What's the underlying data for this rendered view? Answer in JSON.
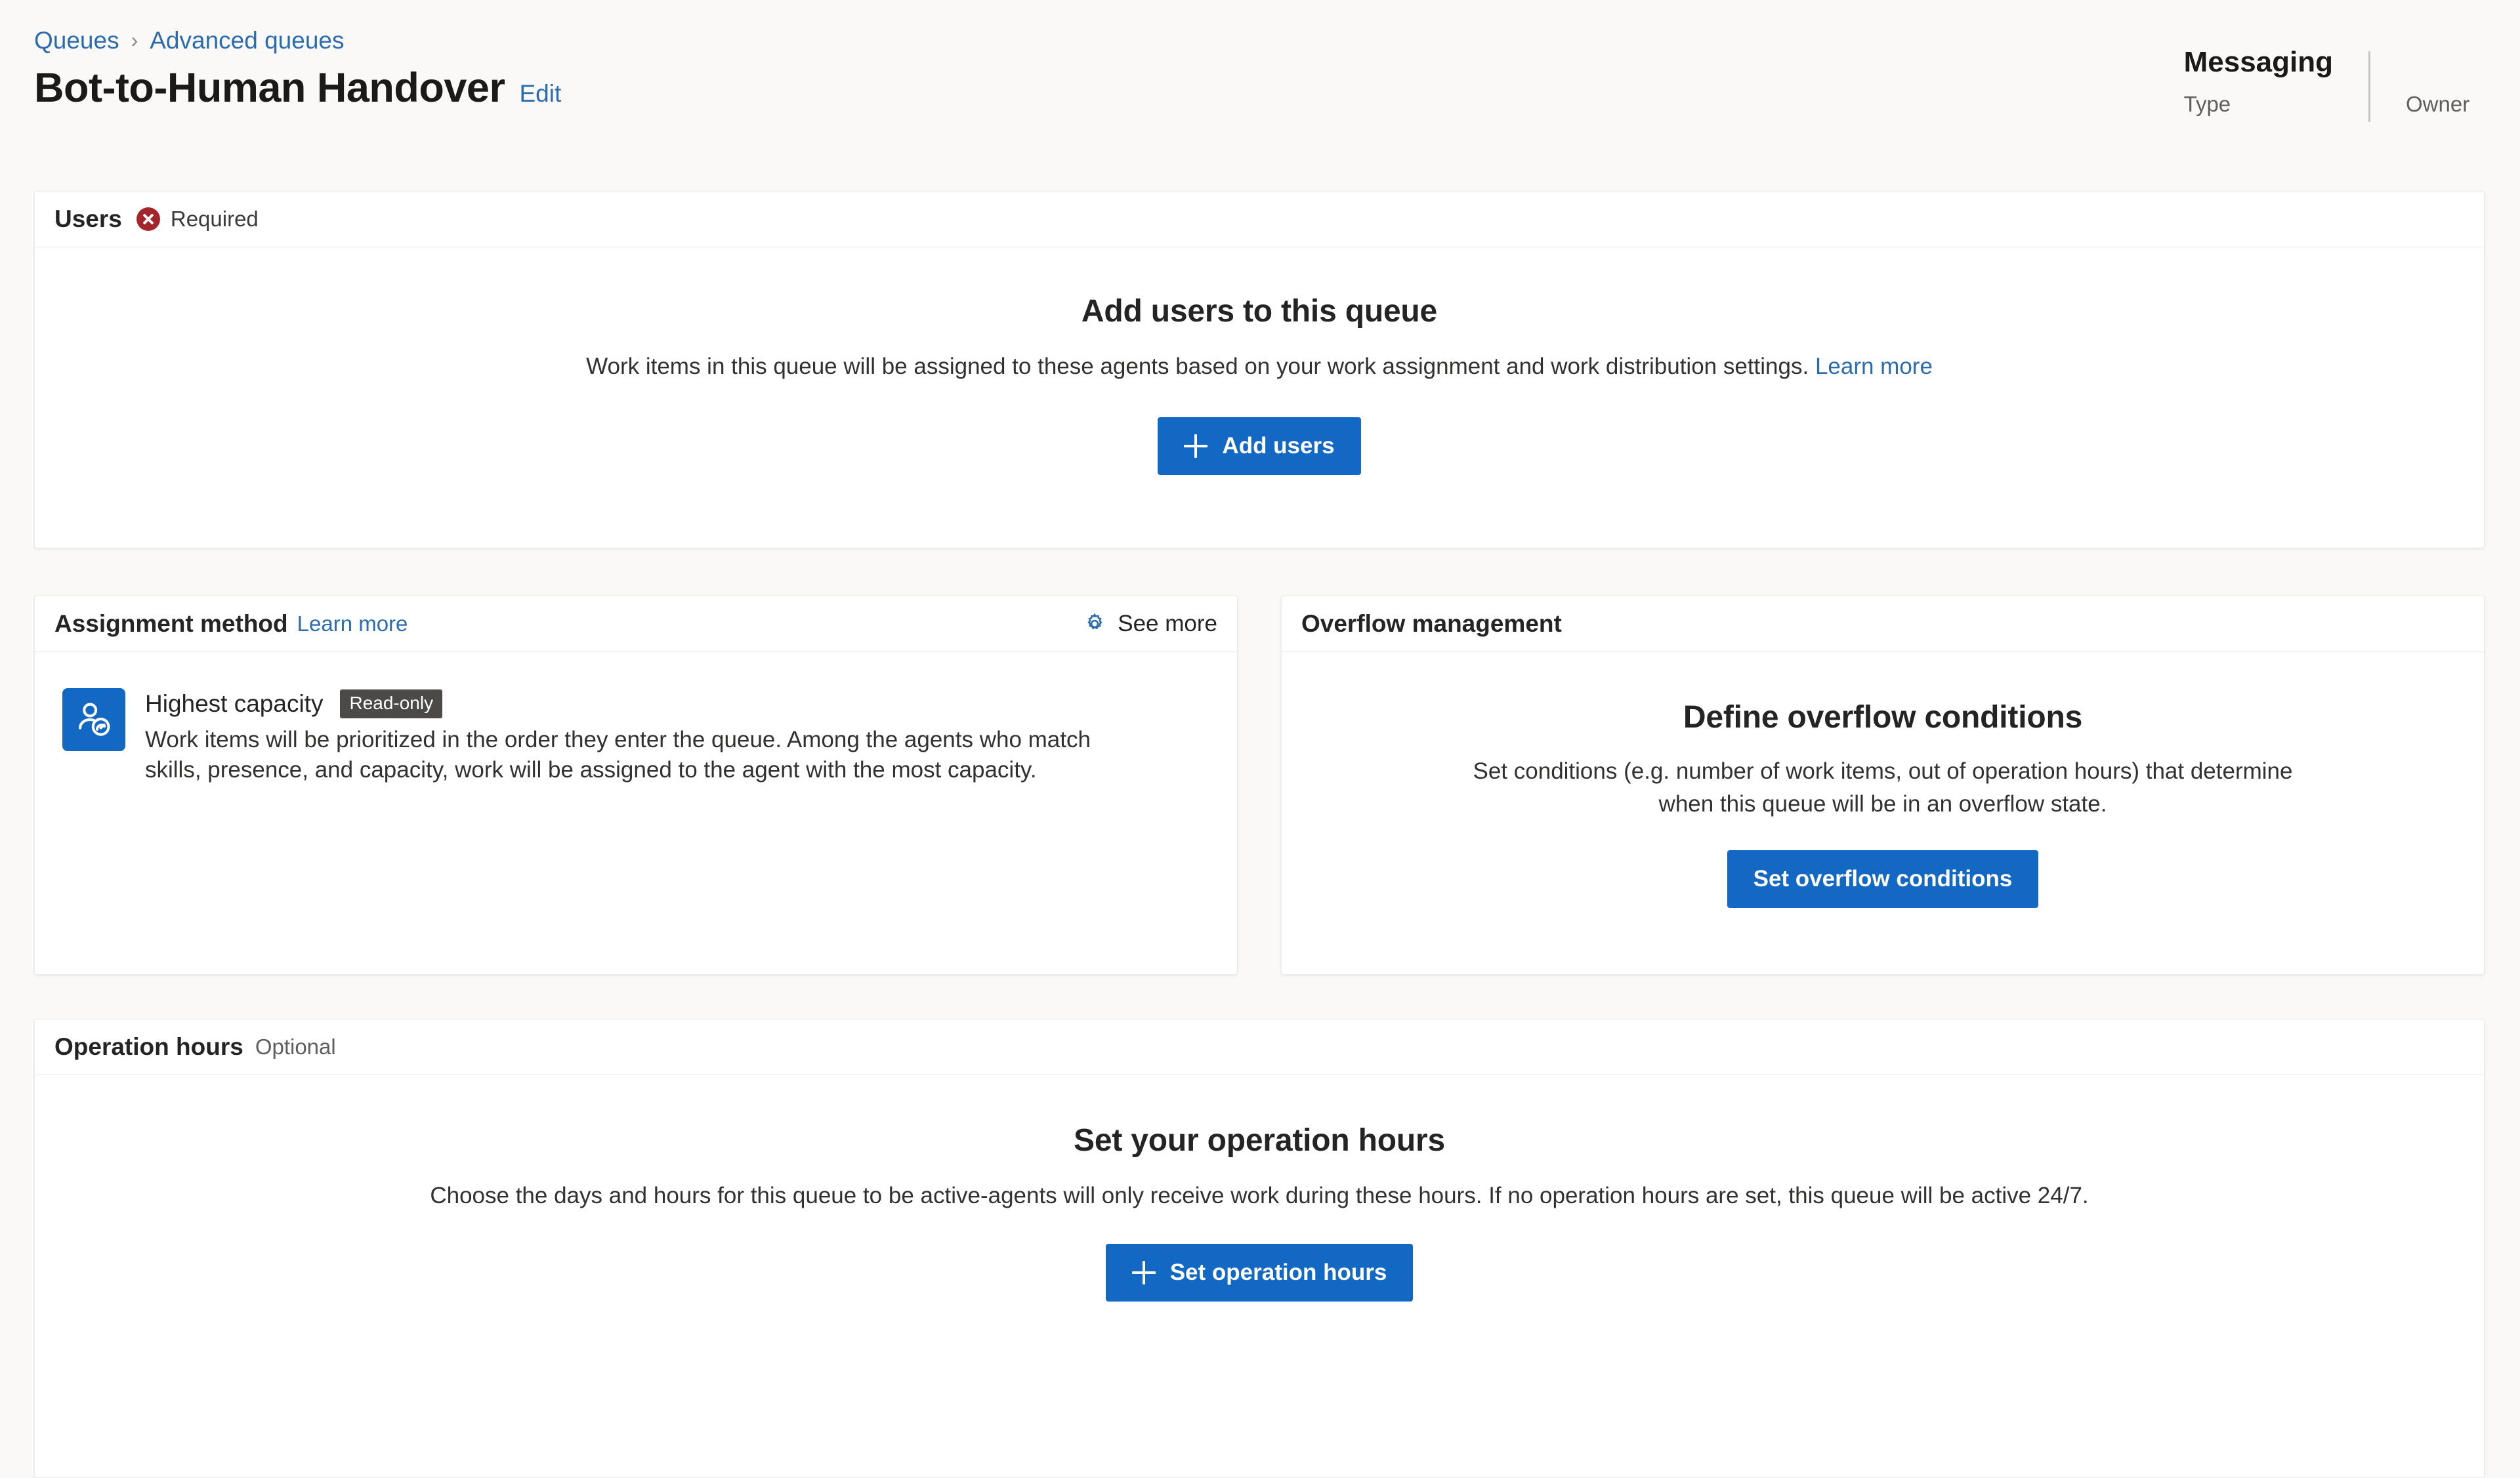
{
  "header": {
    "breadcrumb": [
      {
        "label": "Queues"
      },
      {
        "label": "Advanced queues"
      }
    ],
    "separator": "›",
    "title": "Bot-to-Human Handover",
    "edit_label": "Edit",
    "meta": {
      "type_value": "Messaging",
      "type_label": "Type",
      "owner_value": "",
      "owner_label": "Owner"
    }
  },
  "users_card": {
    "header_title": "Users",
    "required_label": "Required",
    "status_icon": "error-circle-icon",
    "empty_title": "Add users to this queue",
    "empty_desc": "Work items in this queue will be assigned to these agents based on your work assignment and work distribution settings.",
    "learn_more": "Learn more",
    "button_label": "Add users",
    "button_icon": "plus-icon"
  },
  "assignment_card": {
    "header_title": "Assignment method",
    "header_link": "Learn more",
    "see_more_label": "See more",
    "see_more_icon": "gear-icon",
    "method_icon": "user-capacity-icon",
    "method_title": "Highest capacity",
    "method_badge": "Read-only",
    "method_desc": "Work items will be prioritized in the order they enter the queue. Among the agents who match skills, presence, and capacity, work will be assigned to the agent with the most capacity."
  },
  "overflow_card": {
    "header_title": "Overflow management",
    "empty_title": "Define overflow conditions",
    "empty_desc": "Set conditions (e.g. number of work items, out of operation hours) that determine when this queue will be in an overflow state.",
    "button_label": "Set overflow conditions"
  },
  "operation_hours_card": {
    "header_title": "Operation hours",
    "optional_label": "Optional",
    "empty_title": "Set your operation hours",
    "empty_desc": "Choose the days and hours for this queue to be active-agents will only receive work during these hours. If no operation hours are set, this queue will be active 24/7.",
    "button_label": "Set operation hours",
    "button_icon": "plus-icon"
  },
  "colors": {
    "accent": "#1268c3",
    "link": "#2b6cb0",
    "error": "#a4262c",
    "badge": "#4b4a48",
    "page_bg": "#faf9f7"
  }
}
